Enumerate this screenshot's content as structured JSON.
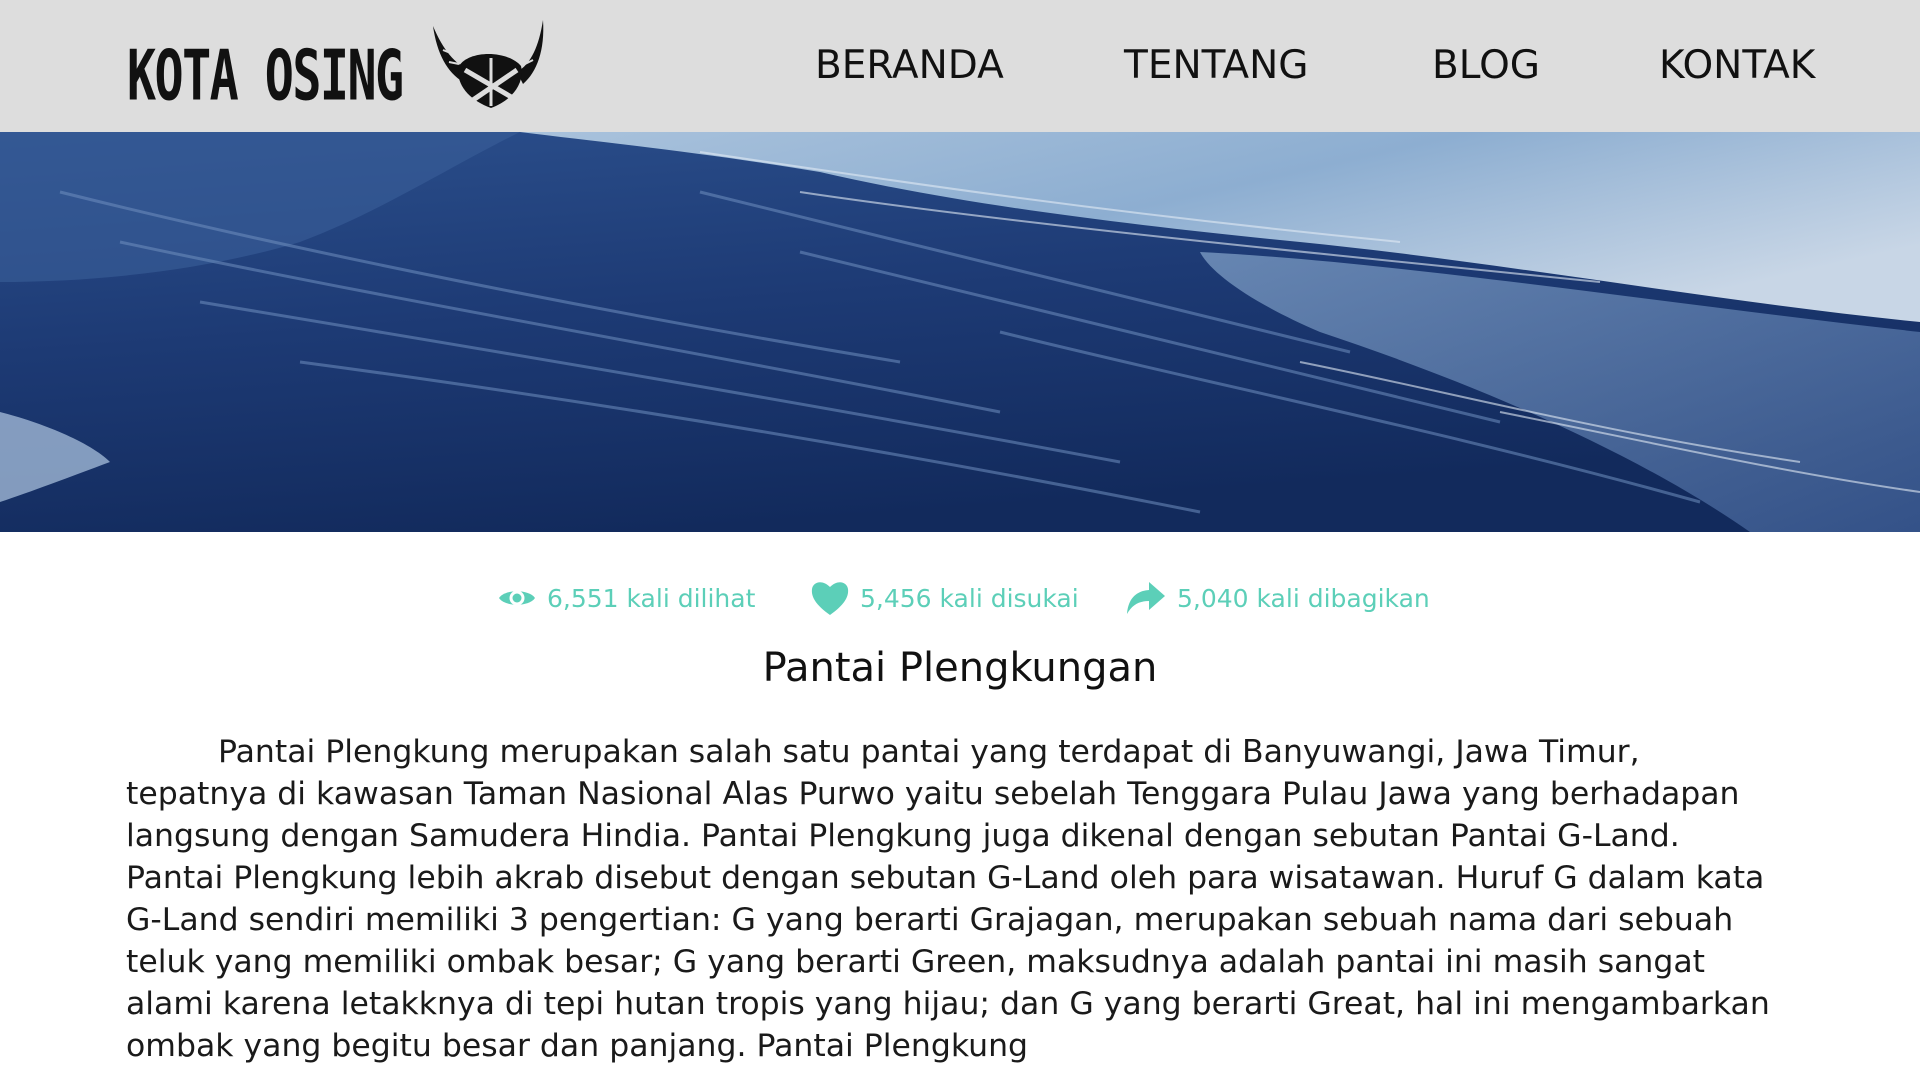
{
  "brand": {
    "name": "KOTA OSING",
    "logo_icon": "osing-horns-mask-icon"
  },
  "nav": {
    "items": [
      {
        "id": "beranda",
        "label": "BERANDA"
      },
      {
        "id": "tentang",
        "label": "TENTANG"
      },
      {
        "id": "blog",
        "label": "BLOG"
      },
      {
        "id": "kontak",
        "label": "KONTAK"
      }
    ]
  },
  "hero": {
    "image": "ocean-wave"
  },
  "stats": {
    "views": {
      "icon": "eye-icon",
      "text": "6,551 kali dilihat"
    },
    "likes": {
      "icon": "heart-icon",
      "text": "5,456 kali disukai"
    },
    "shares": {
      "icon": "share-arrow-icon",
      "text": "5,040 kali dibagikan"
    }
  },
  "article": {
    "title": "Pantai Plengkungan",
    "body": "Pantai Plengkung merupakan salah satu pantai yang terdapat di Banyuwangi, Jawa Timur, tepatnya di kawasan Taman Nasional Alas Purwo yaitu sebelah Tenggara Pulau Jawa yang berhadapan langsung dengan Samudera Hindia. Pantai Plengkung juga dikenal dengan sebutan Pantai G-Land. Pantai Plengkung lebih akrab disebut dengan sebutan G-Land oleh para wisatawan. Huruf G dalam kata G-Land sendiri memiliki 3 pengertian: G yang berarti Grajagan, merupakan sebuah nama dari sebuah teluk yang memiliki ombak besar; G yang berarti Green, maksudnya adalah pantai ini masih sangat alami karena letakknya di tepi hutan tropis yang hijau; dan G yang berarti Great, hal ini mengambarkan ombak yang begitu besar dan panjang. Pantai Plengkung"
  },
  "colors": {
    "navbar_bg": "#dddddd",
    "accent": "#5ccfb8",
    "text": "#111111"
  }
}
